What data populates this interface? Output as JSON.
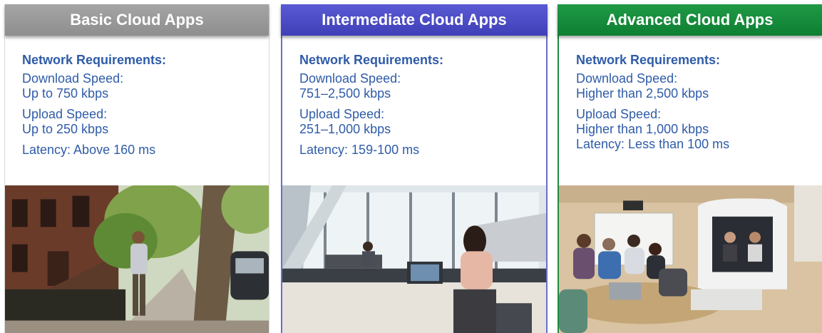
{
  "columns": [
    {
      "title": "Basic Cloud Apps",
      "requirements_label": "Network Requirements:",
      "download_label": "Download Speed:",
      "download_value": "Up to 750 kbps",
      "upload_label": "Upload Speed:",
      "upload_value": "Up to 250 kbps",
      "latency": "Latency:  Above 160 ms",
      "accent": "#9a9a9a"
    },
    {
      "title": "Intermediate Cloud Apps",
      "requirements_label": "Network Requirements:",
      "download_label": "Download Speed:",
      "download_value": "751–2,500 kbps",
      "upload_label": "Upload Speed:",
      "upload_value": "251–1,000 kbps",
      "latency": "Latency:  159-100 ms",
      "accent": "#4b4bc4"
    },
    {
      "title": "Advanced Cloud Apps",
      "requirements_label": "Network Requirements:",
      "download_label": "Download Speed:",
      "download_value": "Higher than 2,500 kbps",
      "upload_label": "Upload Speed:",
      "upload_value": "Higher than 1,000 kbps",
      "latency": "Latency:  Less than 100 ms",
      "accent": "#138a3c"
    }
  ],
  "text_color": "#2f5ca8"
}
